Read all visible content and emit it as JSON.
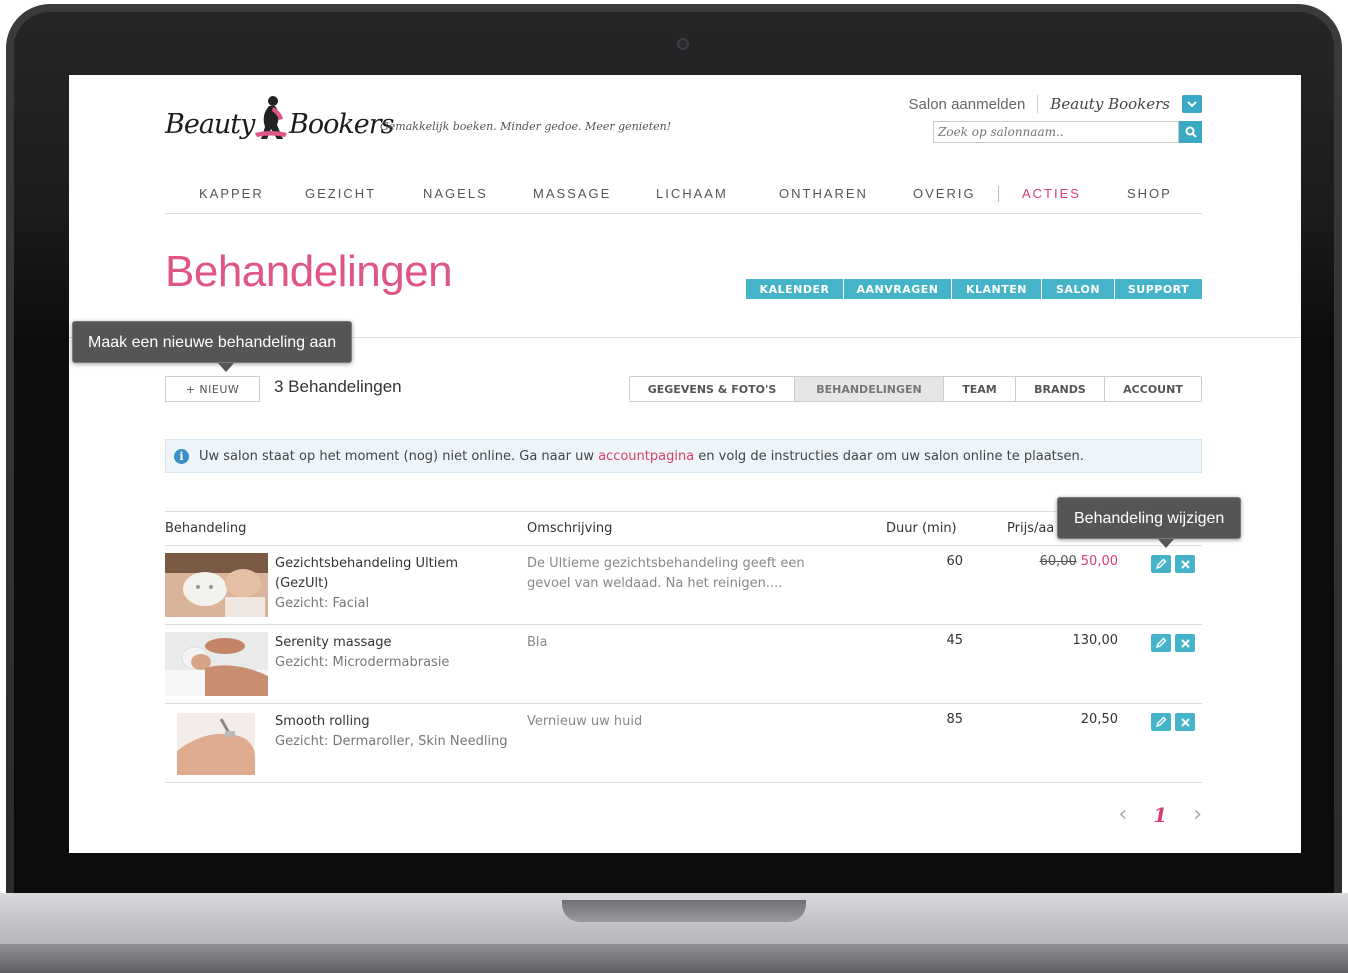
{
  "brand": {
    "logo_left": "Beauty",
    "logo_right": "Bookers",
    "tagline": "Gemakkelijk boeken. Minder gedoe. Meer genieten!"
  },
  "topbar": {
    "salon_link": "Salon aanmelden",
    "user_name": "Beauty Bookers",
    "search_placeholder": "Zoek op salonnaam.."
  },
  "mainnav": {
    "items": [
      "KAPPER",
      "GEZICHT",
      "NAGELS",
      "MASSAGE",
      "LICHAAM",
      "ONTHAREN",
      "OVERIG",
      "ACTIES",
      "SHOP"
    ],
    "active": "ACTIES"
  },
  "page": {
    "title": "Behandelingen",
    "count_title": "3 Behandelingen",
    "new_button": "+ NIEUW",
    "tooltip_new": "Maak een nieuwe behandeling aan",
    "tooltip_edit": "Behandeling wijzigen"
  },
  "tool_tabs": [
    "KALENDER",
    "AANVRAGEN",
    "KLANTEN",
    "SALON",
    "SUPPORT"
  ],
  "sub_tabs": {
    "items": [
      "GEGEVENS & FOTO'S",
      "BEHANDELINGEN",
      "TEAM",
      "BRANDS",
      "ACCOUNT"
    ],
    "active": "BEHANDELINGEN"
  },
  "info": {
    "text_before": "Uw salon staat op het moment (nog) niet online. Ga naar uw ",
    "link": "accountpagina",
    "text_after": " en volg de instructies daar om uw salon online te plaatsen."
  },
  "table": {
    "headers": [
      "Behandeling",
      "Omschrijving",
      "Duur (min)",
      "Prijs/aa"
    ],
    "rows": [
      {
        "name": "Gezichtsbehandeling Ultiem (GezUlt)",
        "category": "Gezicht: Facial",
        "description": "De Ultieme gezichtsbehandeling geeft een gevoel van weldaad. Na het reinigen....",
        "duration": "60",
        "old_price": "60,00",
        "price": "50,00"
      },
      {
        "name": "Serenity massage",
        "category": "Gezicht: Microdermabrasie",
        "description": "Bla",
        "duration": "45",
        "old_price": "",
        "price": "130,00"
      },
      {
        "name": "Smooth rolling",
        "category": "Gezicht: Dermaroller, Skin Needling",
        "description": "Vernieuw uw huid",
        "duration": "85",
        "old_price": "",
        "price": "20,50"
      }
    ]
  },
  "pagination": {
    "current": "1",
    "prev": "‹",
    "next": "›"
  },
  "colors": {
    "accent_pink": "#d6406a",
    "accent_teal": "#45b4c9"
  }
}
